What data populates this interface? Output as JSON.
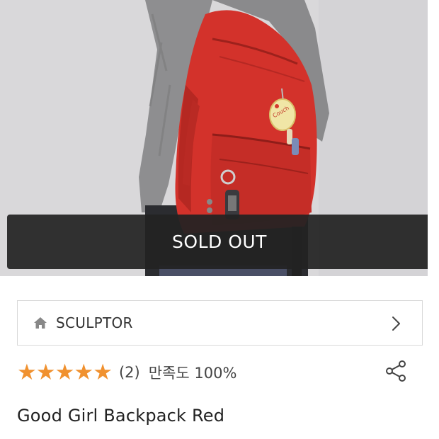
{
  "status": {
    "sold_out_label": "SOLD OUT"
  },
  "store": {
    "name": "SCULPTOR",
    "icon": "home-icon"
  },
  "rating": {
    "stars_filled": 5,
    "stars_total": 5,
    "review_count": "(2)",
    "satisfaction": "만족도 100%"
  },
  "product": {
    "title": "Good Girl Backpack Red",
    "keychain_text": "Couch"
  },
  "colors": {
    "star": "#f0912f",
    "backpack": "#d3322b",
    "banner": "#222222"
  }
}
